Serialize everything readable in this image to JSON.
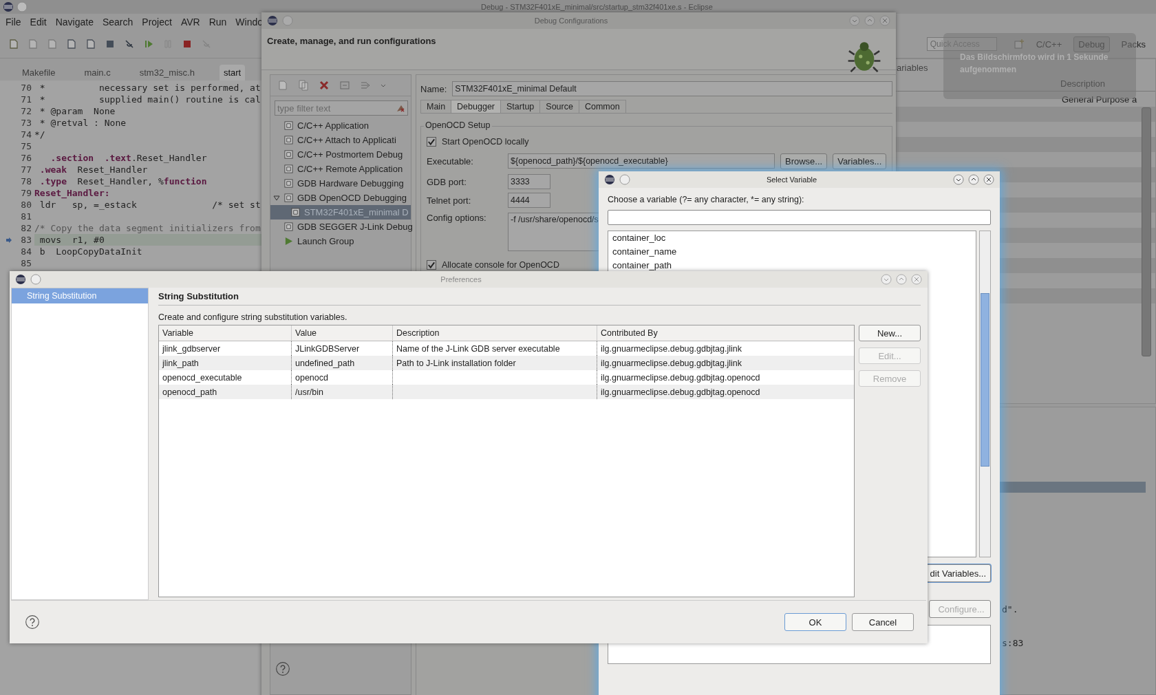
{
  "ide": {
    "title": "Debug - STM32F401xE_minimal/src/startup_stm32f401xe.s - Eclipse",
    "menu": [
      "File",
      "Edit",
      "Navigate",
      "Search",
      "Project",
      "AVR",
      "Run",
      "Windo"
    ],
    "quick_access": {
      "placeholder": "Quick Access"
    },
    "perspectives": [
      {
        "label": "C/C++",
        "selected": false
      },
      {
        "label": "Debug",
        "selected": true
      },
      {
        "label": "Packs",
        "selected": false
      }
    ],
    "editor_tabs": [
      {
        "label": "Makefile",
        "selected": false
      },
      {
        "label": "main.c",
        "selected": false
      },
      {
        "label": "stm32_misc.h",
        "selected": false
      },
      {
        "label": "start",
        "selected": true
      }
    ],
    "code_lines": [
      {
        "number": "70",
        "text": " *          necessary set is performed, at",
        "current": false
      },
      {
        "number": "71",
        "text": " *          supplied main() routine is cal",
        "current": false
      },
      {
        "number": "72",
        "text": " * @param  None",
        "current": false
      },
      {
        "number": "73",
        "text": " * @retval : None",
        "current": false
      },
      {
        "number": "74",
        "text": "*/",
        "current": false
      },
      {
        "number": "75",
        "current": false
      },
      {
        "number": "76",
        "text": "   **.section**  **.text**.Reset_Handler",
        "current": false
      },
      {
        "number": "77",
        "text": " **.weak**  Reset_Handler",
        "current": false
      },
      {
        "number": "78",
        "text": " **.type**  Reset_Handler, %**function**",
        "current": false
      },
      {
        "number": "79",
        "text": "Reset_Handler:",
        "kind": "label",
        "current": false
      },
      {
        "number": "80",
        "text": " ldr   sp, =_estack              /* set st",
        "current": false
      },
      {
        "number": "81",
        "current": false
      },
      {
        "number": "82",
        "text": "/* Copy the data segment initializers from",
        "kind": "comment",
        "current": false
      },
      {
        "number": "83",
        "text": " movs  r1, #0",
        "current": true
      },
      {
        "number": "84",
        "text": " b  LoopCopyDataInit",
        "current": false
      },
      {
        "number": "85",
        "current": false
      }
    ],
    "variables_view": {
      "tab": "ariables",
      "column": "Description",
      "cell": "General Purpose a"
    },
    "console_lines": [
      "d\".",
      "s:83"
    ]
  },
  "notification": "Das Bildschirmfoto wird in 1 Sekunde aufgenommen",
  "debug_configurations": {
    "title": "Debug Configurations",
    "header": "Create, manage, and run configurations",
    "filter": {
      "placeholder": "type filter text"
    },
    "tree": [
      {
        "label": "C/C++ Application",
        "kind": "config",
        "selected": false
      },
      {
        "label": "C/C++ Attach to Applicati",
        "kind": "config",
        "selected": false
      },
      {
        "label": "C/C++ Postmortem Debug",
        "kind": "config",
        "selected": false
      },
      {
        "label": "C/C++ Remote Application",
        "kind": "config",
        "selected": false
      },
      {
        "label": "GDB Hardware Debugging",
        "kind": "config",
        "selected": false
      },
      {
        "label": "GDB OpenOCD Debugging",
        "kind": "config",
        "selected": false,
        "expanded": true,
        "children": [
          {
            "label": "STM32F401xE_minimal D",
            "kind": "config",
            "selected": true
          }
        ]
      },
      {
        "label": "GDB SEGGER J-Link Debug",
        "kind": "config",
        "selected": false
      },
      {
        "label": "Launch Group",
        "kind": "group",
        "selected": false
      }
    ],
    "name_label": "Name:",
    "name_value": "STM32F401xE_minimal Default",
    "tabs": [
      {
        "label": "Main",
        "selected": false
      },
      {
        "label": "Debugger",
        "selected": true
      },
      {
        "label": "Startup",
        "selected": false
      },
      {
        "label": "Source",
        "selected": false
      },
      {
        "label": "Common",
        "selected": false
      }
    ],
    "group_title": "OpenOCD Setup",
    "start_locally": {
      "label": "Start OpenOCD locally",
      "checked": true
    },
    "executable": {
      "label": "Executable:",
      "value": "${openocd_path}/${openocd_executable}"
    },
    "buttons": [
      "Browse...",
      "Variables..."
    ],
    "gdb_port": {
      "label": "GDB port:",
      "value": "3333"
    },
    "telnet_port": {
      "label": "Telnet port:",
      "value": "4444"
    },
    "config_options": {
      "label": "Config options:",
      "value": "-f /usr/share/openocd/s"
    },
    "allocate_console": {
      "label": "Allocate console for OpenOCD",
      "checked": true
    }
  },
  "select_variable": {
    "title": "Select Variable",
    "prompt": "Choose a variable (?= any character, *= any string):",
    "items": [
      {
        "label": "container_loc",
        "selected": false
      },
      {
        "label": "container_name",
        "selected": false
      },
      {
        "label": "container_path",
        "selected": false
      }
    ],
    "edit_button": "dit Variables...",
    "configure_button": {
      "label": "Configure...",
      "disabled": true
    }
  },
  "preferences": {
    "title": "Preferences",
    "nav": [
      {
        "label": "String Substitution",
        "selected": true
      }
    ],
    "heading": "String Substitution",
    "intro": "Create and configure string substitution variables.",
    "table": {
      "columns": [
        "Variable",
        "Value",
        "Description",
        "Contributed By"
      ],
      "rows": [
        [
          "jlink_gdbserver",
          "JLinkGDBServer",
          "Name of the J-Link GDB server executable",
          "ilg.gnuarmeclipse.debug.gdbjtag.jlink"
        ],
        [
          "jlink_path",
          "undefined_path",
          "Path to J-Link installation folder",
          "ilg.gnuarmeclipse.debug.gdbjtag.jlink"
        ],
        [
          "openocd_executable",
          "openocd",
          "",
          "ilg.gnuarmeclipse.debug.gdbjtag.openocd"
        ],
        [
          "openocd_path",
          "/usr/bin",
          "",
          "ilg.gnuarmeclipse.debug.gdbjtag.openocd"
        ]
      ]
    },
    "buttons": [
      {
        "label": "New...",
        "disabled": false
      },
      {
        "label": "Edit...",
        "disabled": true
      },
      {
        "label": "Remove",
        "disabled": true
      }
    ],
    "ok": "OK",
    "cancel": "Cancel"
  }
}
